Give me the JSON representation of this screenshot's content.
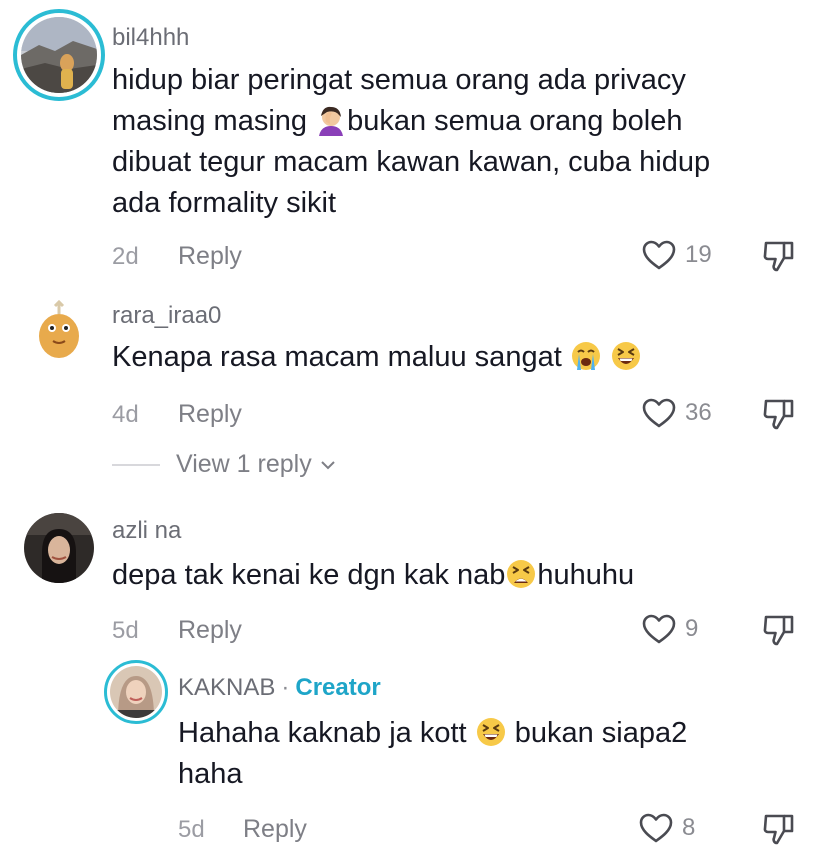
{
  "comments": [
    {
      "username": "bil4hhh",
      "text_line1": "hidup biar peringat semua orang ada privacy",
      "text_line2_a": "masing masing ",
      "text_line2_b": "bukan semua orang boleh",
      "text_line3": "dibuat tegur macam kawan kawan, cuba hidup",
      "text_line4": "ada formality sikit",
      "time": "2d",
      "reply_label": "Reply",
      "likes": "19",
      "emoji": "person-facepalming-emoji"
    },
    {
      "username": "rara_iraa0",
      "text": "Kenapa rasa macam maluu sangat ",
      "time": "4d",
      "reply_label": "Reply",
      "likes": "36",
      "view_replies_label": "View 1 reply",
      "emojis": [
        "loudly-crying-face-emoji",
        "grinning-squinting-face-emoji"
      ]
    },
    {
      "username": "azli na",
      "text_a": "depa tak kenai ke dgn kak nab",
      "text_b": "huhuhu",
      "time": "5d",
      "reply_label": "Reply",
      "likes": "9",
      "emoji": "tired-face-emoji"
    }
  ],
  "reply": {
    "username": "KAKNAB",
    "separator": "·",
    "badge": "Creator",
    "text_line1_a": "Hahaha kaknab ja kott ",
    "text_line1_b": " bukan siapa2",
    "text_line2": "haha",
    "time": "5d",
    "reply_label": "Reply",
    "likes": "8",
    "emoji": "grinning-squinting-face-emoji"
  },
  "colors": {
    "creator_badge": "#1ea5c8",
    "story_ring": "#2bbcd4",
    "primary_text": "#161823",
    "secondary_text": "#7e7f86"
  }
}
